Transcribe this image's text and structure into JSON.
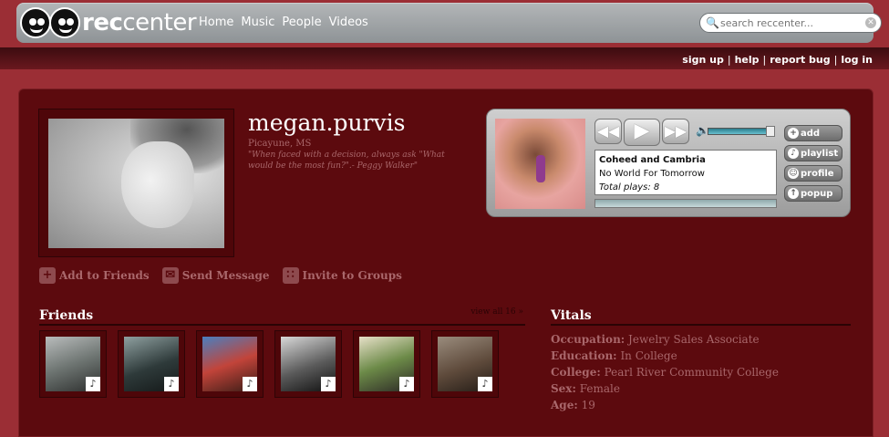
{
  "header": {
    "logo_rec": "rec",
    "logo_center": "center",
    "nav": [
      "Home",
      "Music",
      "People",
      "Videos"
    ],
    "search_placeholder": "search reccenter..."
  },
  "user_links": [
    "sign up",
    "help",
    "report bug",
    "log in"
  ],
  "profile": {
    "username": "megan.purvis",
    "location": "Picayune, MS",
    "quote": "\"When faced with a decision, always ask \"What would be the most fun?\".- Peggy Walker\""
  },
  "actions": [
    {
      "label": "Add to Friends",
      "icon": "plus-icon"
    },
    {
      "label": "Send Message",
      "icon": "envelope-icon"
    },
    {
      "label": "Invite to Groups",
      "icon": "group-icon"
    }
  ],
  "player": {
    "artist": "Coheed and Cambria",
    "track": "No World For Tomorrow",
    "plays_text": "Total plays: 8",
    "buttons": [
      "add",
      "playlist",
      "profile",
      "popup"
    ]
  },
  "friends": {
    "title": "Friends",
    "view_all": "view all 16 »"
  },
  "vitals": {
    "title": "Vitals",
    "rows": [
      {
        "key": "Occupation:",
        "value": "Jewelry Sales Associate"
      },
      {
        "key": "Education:",
        "value": "In College"
      },
      {
        "key": "College:",
        "value": "Pearl River Community College"
      },
      {
        "key": "Sex:",
        "value": "Female"
      },
      {
        "key": "Age:",
        "value": "19"
      }
    ]
  }
}
